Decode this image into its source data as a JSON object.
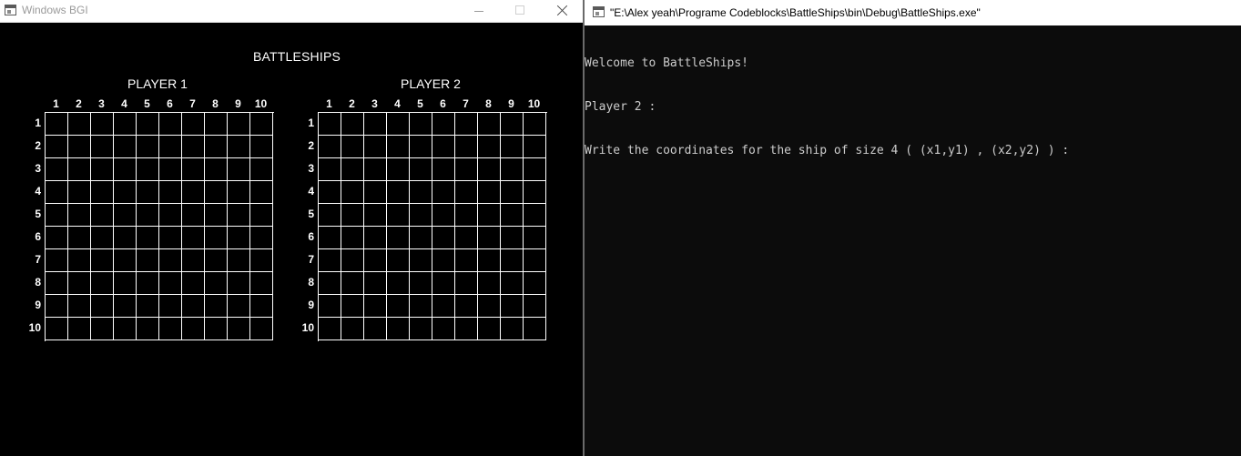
{
  "bgi_window": {
    "title": "Windows BGI",
    "game_title": "BATTLESHIPS",
    "players": [
      "PLAYER 1",
      "PLAYER 2"
    ],
    "column_labels": [
      "1",
      "2",
      "3",
      "4",
      "5",
      "6",
      "7",
      "8",
      "9",
      "10"
    ],
    "row_labels": [
      "1",
      "2",
      "3",
      "4",
      "5",
      "6",
      "7",
      "8",
      "9",
      "10"
    ]
  },
  "console_window": {
    "title": "\"E:\\Alex yeah\\Programe Codeblocks\\BattleShips\\bin\\Debug\\BattleShips.exe\"",
    "lines": [
      "Welcome to BattleShips!",
      "Player 2 :",
      "Write the coordinates for the ship of size 4 ( (x1,y1) , (x2,y2) ) :"
    ]
  }
}
